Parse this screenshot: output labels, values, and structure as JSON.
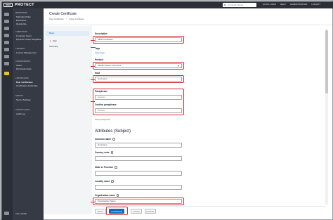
{
  "topbar": {
    "logo": "eset",
    "product": "PROTECT",
    "search_placeholder": "Computer Name",
    "items": [
      "QUICK LINKS",
      "HELP",
      "ADMINISTRATOR",
      "LOGOUT"
    ]
  },
  "nav": {
    "groups": [
      {
        "head": "MONITORING",
        "items": [
          "Submitted Files",
          "Exclusions",
          "Quarantine"
        ]
      },
      {
        "head": "COMPUTERS",
        "items": [
          "Computer Users",
          "Dynamic Group Templates"
        ]
      },
      {
        "head": "LICENSES",
        "items": [
          "License Management"
        ]
      },
      {
        "head": "ACCESS RIGHTS",
        "items": [
          "Users",
          "Permission Sets"
        ]
      },
      {
        "head": "CERTIFICATES",
        "items": [
          "Peer Certificates",
          "Certification Authorities"
        ]
      },
      {
        "head": "SERVER",
        "items": [
          "Server Settings"
        ]
      },
      {
        "head": "ACTIVITY AUDIT",
        "items": [
          "Audit Log"
        ]
      }
    ],
    "collapse": "COLLAPSE"
  },
  "header": {
    "title": "Create Certificate",
    "breadcrumb": [
      "Peer Certificates",
      ">",
      "Action Certificate"
    ]
  },
  "steps": {
    "basic": "Basic",
    "sign": "Sign",
    "summary": "Summary"
  },
  "form": {
    "description_label": "Description",
    "description_value": "MDM Certificate",
    "tags_label": "Tags",
    "tags_link": "Select tags",
    "product_label": "Product",
    "product_value": "Mobile Device Connector",
    "host_label": "Host",
    "host_value": "Hostname",
    "passphrase_label": "Passphrase",
    "passphrase_value": "••••••••••",
    "confirm_label": "Confirm passphrase",
    "confirm_value": "••••••••••",
    "show_link": "Show passphrase",
    "attributes_title": "Attributes (Subject)",
    "common_name_label": "Common name",
    "common_name_value": "Hostname",
    "country_label": "Country code",
    "state_label": "State or Province",
    "locality_label": "Locality name",
    "org_label": "Organization name",
    "org_value": "Organization Name"
  },
  "footer": {
    "back": "BACK",
    "continue": "CONTINUE",
    "finish": "FINISH",
    "cancel": "CANCEL"
  },
  "colors": {
    "sidebar": "#2b2f38",
    "accent": "#0b6bbf",
    "highlight": "#d32f2f",
    "active_icon": "#f0c419"
  }
}
